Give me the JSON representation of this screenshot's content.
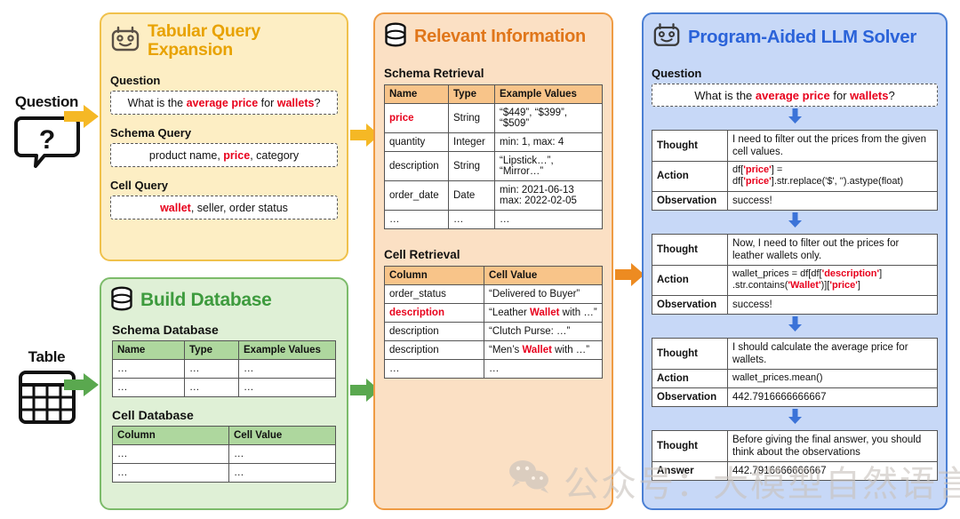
{
  "inputs": {
    "question_label": "Question",
    "question_icon": "question-speech-bubble-icon",
    "question_mark": "?",
    "table_label": "Table",
    "table_icon": "table-grid-icon"
  },
  "arrows": {
    "question_to_expansion": "arrow-right-yellow",
    "table_to_build": "arrow-right-green",
    "expansion_to_relevant": "arrow-right-yellow",
    "build_to_relevant": "arrow-right-green",
    "relevant_to_solver": "arrow-right-orange",
    "step_down": "arrow-down-blue"
  },
  "panels": {
    "expansion": {
      "icon": "robot-icon",
      "title": "Tabular Query Expansion",
      "sections": [
        {
          "label": "Question",
          "parts": [
            {
              "text": "What is the ",
              "hl": false
            },
            {
              "text": "average price",
              "hl": true
            },
            {
              "text": " for ",
              "hl": false
            },
            {
              "text": "wallets",
              "hl": true
            },
            {
              "text": "?",
              "hl": false
            }
          ]
        },
        {
          "label": "Schema Query",
          "parts": [
            {
              "text": "product name, ",
              "hl": false
            },
            {
              "text": "price",
              "hl": true
            },
            {
              "text": ", category",
              "hl": false
            }
          ]
        },
        {
          "label": "Cell Query",
          "parts": [
            {
              "text": "wallet",
              "hl": true
            },
            {
              "text": ", seller, order status",
              "hl": false
            }
          ]
        }
      ]
    },
    "build": {
      "icon": "database-icon",
      "title": "Build Database",
      "schema": {
        "label": "Schema Database",
        "headers": [
          "Name",
          "Type",
          "Example Values"
        ],
        "rows": [
          [
            "…",
            "…",
            "…"
          ],
          [
            "…",
            "…",
            "…"
          ]
        ]
      },
      "cell": {
        "label": "Cell Database",
        "headers": [
          "Column",
          "Cell Value"
        ],
        "rows": [
          [
            "…",
            "…"
          ],
          [
            "…",
            "…"
          ]
        ]
      }
    },
    "relevant": {
      "icon": "database-icon",
      "title": "Relevant Information",
      "schema": {
        "label": "Schema Retrieval",
        "headers": [
          "Name",
          "Type",
          "Example Values"
        ],
        "rows": [
          {
            "name": "price",
            "name_hl": true,
            "type": "String",
            "values": "“$449”, “$399”, “$509”"
          },
          {
            "name": "quantity",
            "name_hl": false,
            "type": "Integer",
            "values": "min: 1, max: 4"
          },
          {
            "name": "description",
            "name_hl": false,
            "type": "String",
            "values": "“Lipstick…”, “Mirror…”"
          },
          {
            "name": "order_date",
            "name_hl": false,
            "type": "Date",
            "values": "min: 2021-06-13\nmax: 2022-02-05"
          },
          {
            "name": "…",
            "name_hl": false,
            "type": "…",
            "values": "…"
          }
        ]
      },
      "cell": {
        "label": "Cell Retrieval",
        "headers": [
          "Column",
          "Cell Value"
        ],
        "rows": [
          {
            "column": "order_status",
            "column_hl": false,
            "value_parts": [
              {
                "text": "“Delivered to Buyer”",
                "hl": false
              }
            ]
          },
          {
            "column": "description",
            "column_hl": true,
            "value_parts": [
              {
                "text": "“Leather ",
                "hl": false
              },
              {
                "text": "Wallet",
                "hl": true
              },
              {
                "text": " with …”",
                "hl": false
              }
            ]
          },
          {
            "column": "description",
            "column_hl": false,
            "value_parts": [
              {
                "text": "“Clutch Purse: …”",
                "hl": false
              }
            ]
          },
          {
            "column": "description",
            "column_hl": false,
            "value_parts": [
              {
                "text": "“Men’s ",
                "hl": false
              },
              {
                "text": "Wallet",
                "hl": true
              },
              {
                "text": " with …”",
                "hl": false
              }
            ]
          },
          {
            "column": "…",
            "column_hl": false,
            "value_parts": [
              {
                "text": "…",
                "hl": false
              }
            ]
          }
        ]
      }
    },
    "solver": {
      "icon": "robot-icon",
      "title": "Program-Aided LLM Solver",
      "question_label": "Question",
      "question_parts": [
        {
          "text": "What is the ",
          "hl": false
        },
        {
          "text": "average price",
          "hl": true
        },
        {
          "text": " for ",
          "hl": false
        },
        {
          "text": "wallets",
          "hl": true
        },
        {
          "text": "?",
          "hl": false
        }
      ],
      "row_keys": {
        "thought": "Thought",
        "action": "Action",
        "observation": "Observation",
        "answer": "Answer"
      },
      "steps": [
        {
          "thought": "I need to filter out the prices from the given cell values.",
          "action_parts": [
            {
              "text": "df[",
              "hl": false
            },
            {
              "text": "'price'",
              "hl": true
            },
            {
              "text": "] =\ndf[",
              "hl": false
            },
            {
              "text": "'price'",
              "hl": true
            },
            {
              "text": "].str.replace('$', '').astype(float)",
              "hl": false
            }
          ],
          "observation": "success!"
        },
        {
          "thought": "Now, I need to filter out the prices for leather wallets only.",
          "action_parts": [
            {
              "text": "wallet_prices = df[df[",
              "hl": false
            },
            {
              "text": "'description'",
              "hl": true
            },
            {
              "text": "]\n.str.contains(",
              "hl": false
            },
            {
              "text": "'Wallet'",
              "hl": true
            },
            {
              "text": ")][",
              "hl": false
            },
            {
              "text": "'price'",
              "hl": true
            },
            {
              "text": "]",
              "hl": false
            }
          ],
          "observation": "success!"
        },
        {
          "thought": "I should calculate the average price for wallets.",
          "action_parts": [
            {
              "text": "wallet_prices.mean()",
              "hl": false
            }
          ],
          "observation": "442.7916666666667"
        },
        {
          "thought": "Before giving the final answer, you should think about the observations",
          "answer": "442.7916666666667"
        }
      ]
    }
  },
  "watermark": {
    "icon": "wechat-icon",
    "text": "公众号：大模型自然语言处理"
  }
}
